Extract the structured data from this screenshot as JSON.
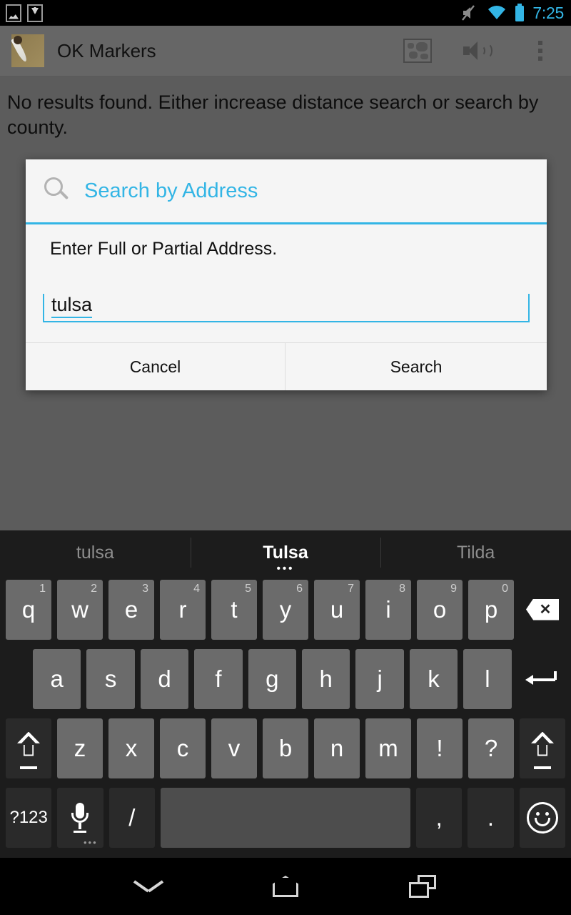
{
  "statusbar": {
    "notifications": [
      {
        "icon": "image-notification-icon"
      },
      {
        "icon": "download-notification-icon"
      }
    ],
    "mute_icon": "volume-muted-icon",
    "wifi_icon": "wifi-icon",
    "battery_icon": "battery-full-icon",
    "time": "7:25",
    "accent_color": "#33b5e5"
  },
  "actionbar": {
    "app_icon": "feather-quill-icon",
    "title": "OK Markers",
    "actions": [
      {
        "name": "map-view-button",
        "icon": "map-icon"
      },
      {
        "name": "sound-button",
        "icon": "speaker-icon"
      },
      {
        "name": "overflow-menu-button",
        "icon": "more-vert-icon"
      }
    ]
  },
  "content": {
    "message": "No results found.  Either increase distance search or search by county."
  },
  "dialog": {
    "search_icon": "search-icon",
    "title": "Search by Address",
    "title_color": "#33b5e5",
    "prompt": "Enter Full or Partial Address.",
    "input_value": "tulsa",
    "input_placeholder": "",
    "buttons": {
      "cancel": "Cancel",
      "search": "Search"
    }
  },
  "keyboard": {
    "suggestions": [
      {
        "text": "tulsa",
        "active": false
      },
      {
        "text": "Tulsa",
        "active": true,
        "marker": "•••"
      },
      {
        "text": "Tilda",
        "active": false
      }
    ],
    "row1": [
      {
        "key": "q",
        "hint": "1"
      },
      {
        "key": "w",
        "hint": "2"
      },
      {
        "key": "e",
        "hint": "3"
      },
      {
        "key": "r",
        "hint": "4"
      },
      {
        "key": "t",
        "hint": "5"
      },
      {
        "key": "y",
        "hint": "6"
      },
      {
        "key": "u",
        "hint": "7"
      },
      {
        "key": "i",
        "hint": "8"
      },
      {
        "key": "o",
        "hint": "9"
      },
      {
        "key": "p",
        "hint": "0"
      }
    ],
    "backspace": "backspace-key",
    "row2": [
      "a",
      "s",
      "d",
      "f",
      "g",
      "h",
      "j",
      "k",
      "l"
    ],
    "enter": "enter-key",
    "row3": [
      "z",
      "x",
      "c",
      "v",
      "b",
      "n",
      "m",
      "!",
      "?"
    ],
    "shift_left": "shift-key",
    "shift_right": "shift-key",
    "row4": {
      "symbols": "?123",
      "mic": "microphone-key",
      "mic_sub": "•••",
      "slash": "/",
      "space": "",
      "comma": ",",
      "period": ".",
      "emoji": "emoji-key"
    }
  },
  "navbar": {
    "back": "hide-keyboard-chevron-icon",
    "home": "home-icon",
    "recents": "recents-icon"
  }
}
